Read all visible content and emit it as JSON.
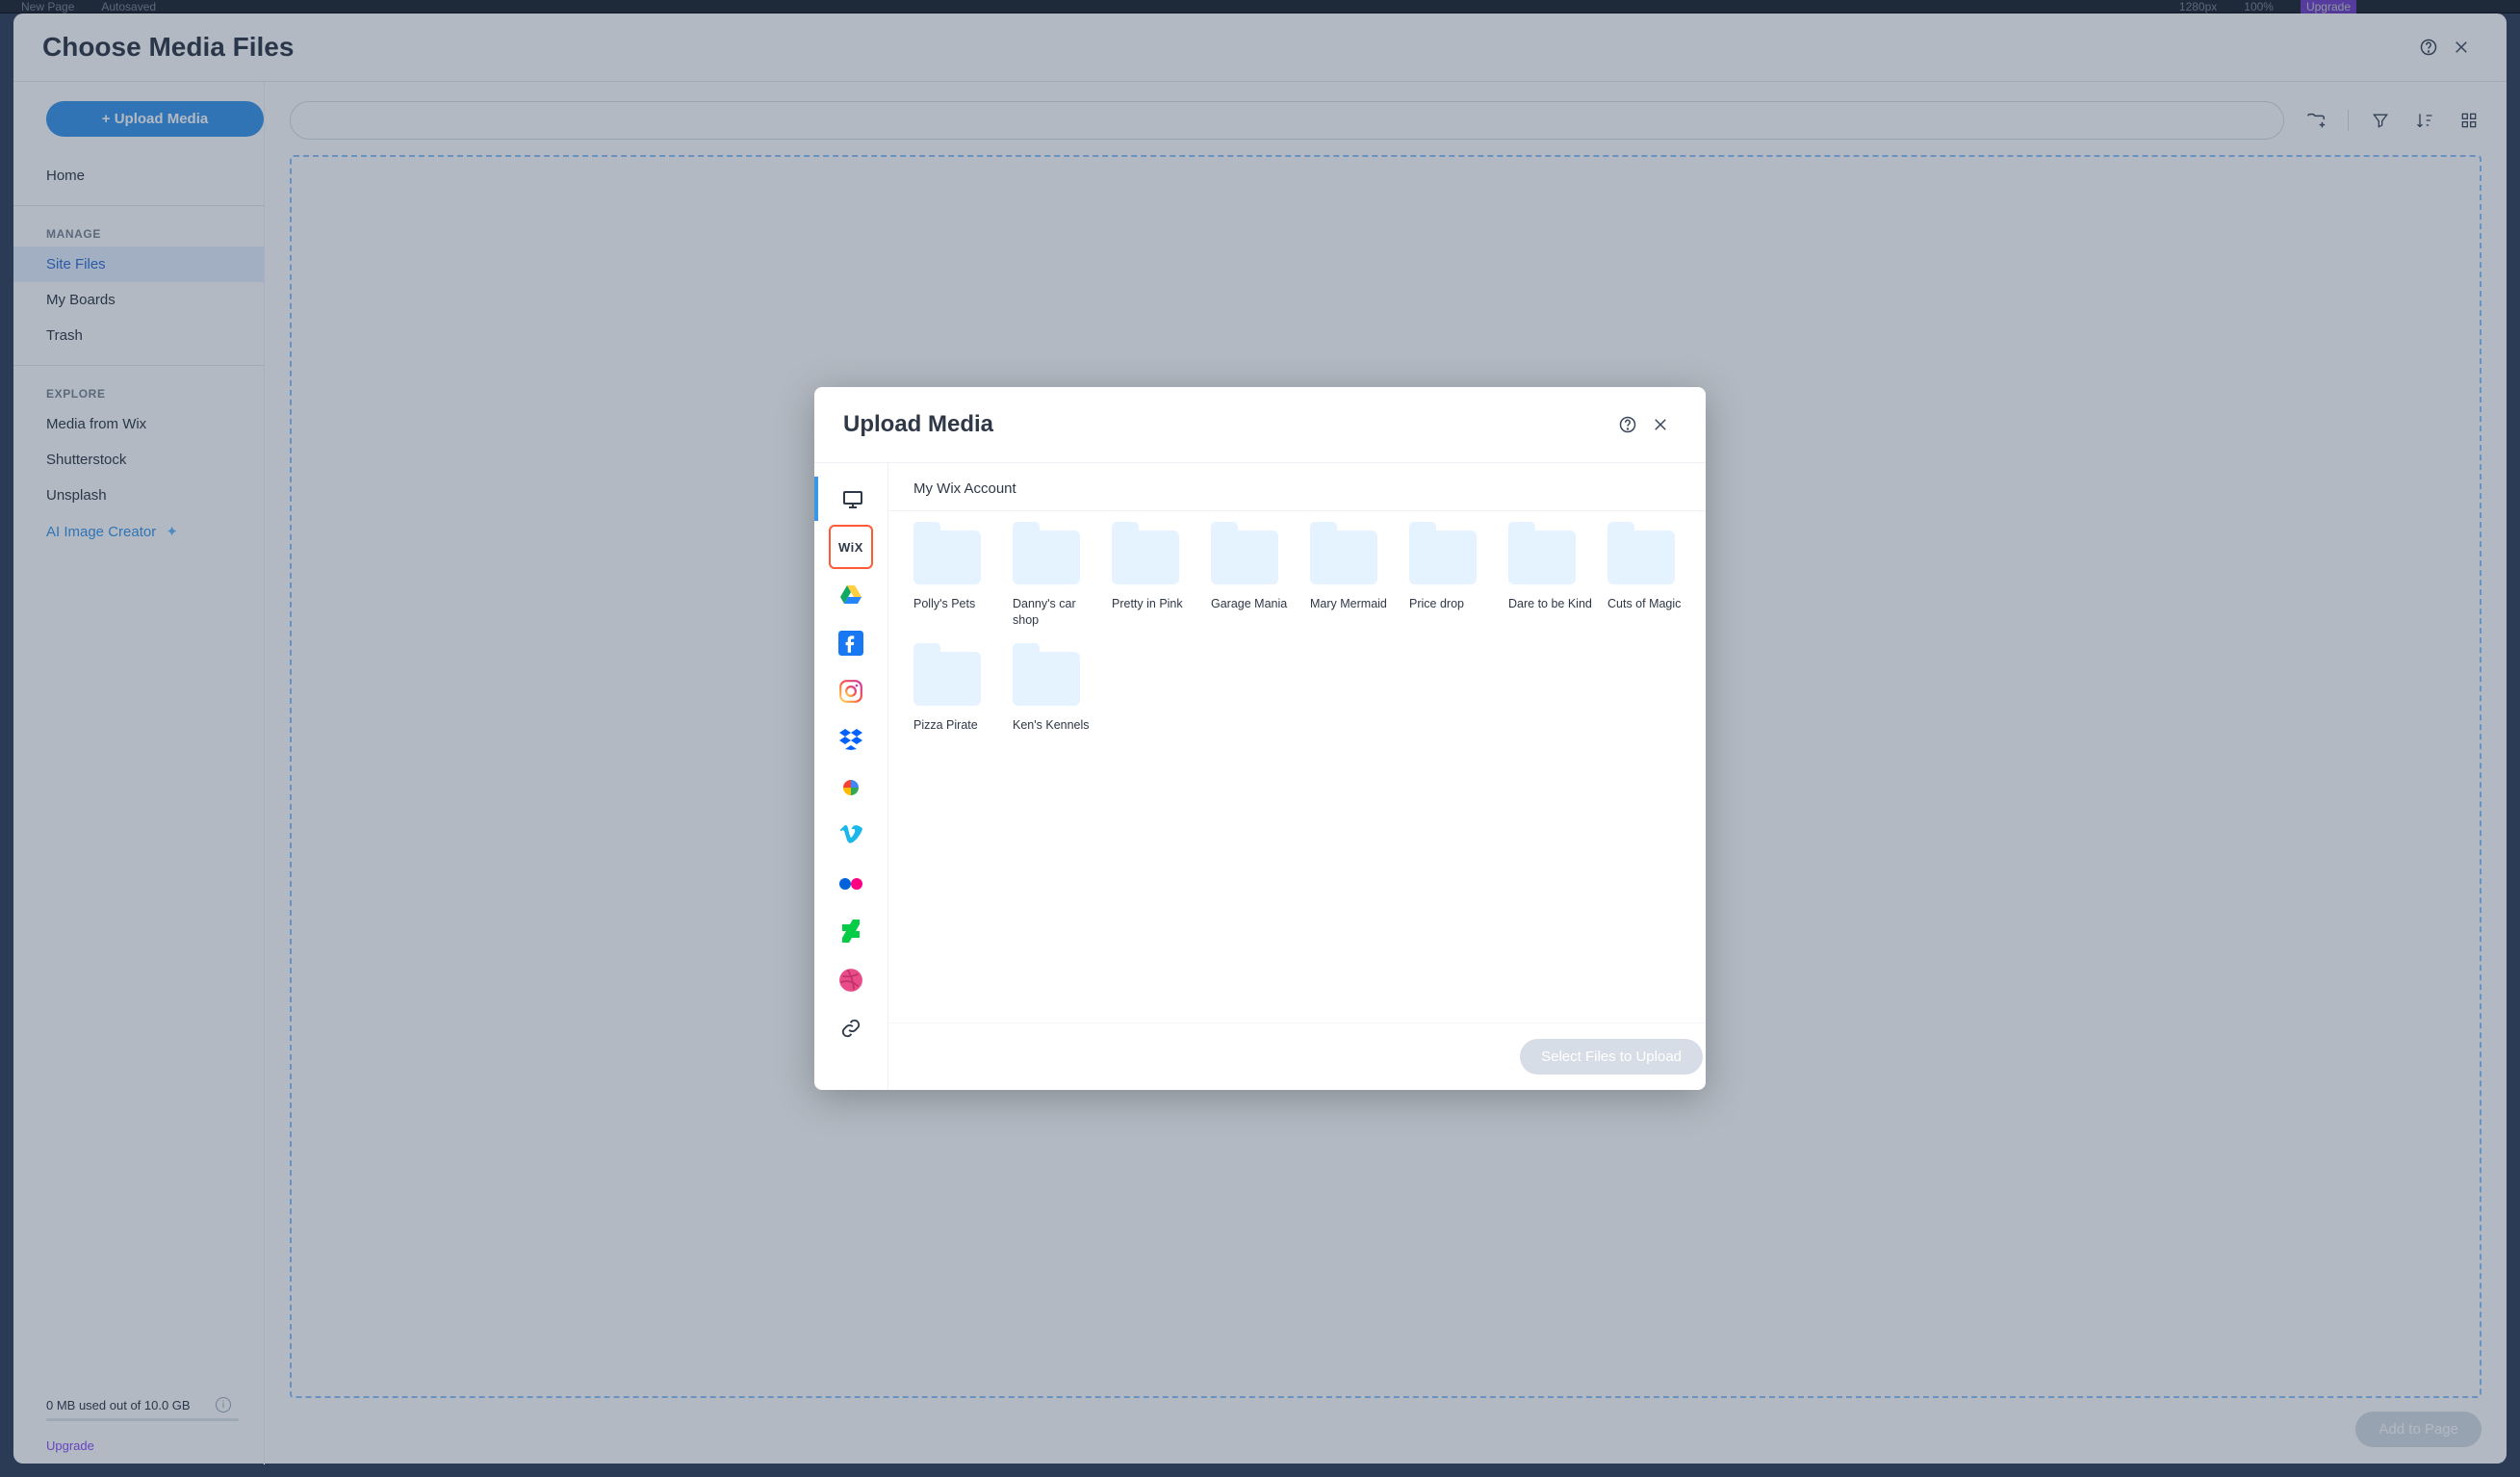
{
  "topbar": {
    "new_page": "New Page",
    "autosaved": "Autosaved",
    "zoom_px": "1280px",
    "zoom_pct": "100%",
    "upgrade": "Upgrade"
  },
  "outer": {
    "title": "Choose Media Files",
    "upload_btn": "+ Upload Media",
    "nav": {
      "home": "Home",
      "manage": "MANAGE",
      "site_files": "Site Files",
      "my_boards": "My Boards",
      "trash": "Trash",
      "explore": "EXPLORE",
      "media_from_wix": "Media from Wix",
      "shutterstock": "Shutterstock",
      "unsplash": "Unsplash",
      "ai": "AI Image Creator"
    },
    "storage": "0 MB used out of 10.0 GB",
    "upgrade": "Upgrade",
    "add_to_page": "Add to Page"
  },
  "inner": {
    "title": "Upload Media",
    "breadcrumb": "My Wix Account",
    "sources": [
      "computer",
      "wix",
      "google-drive",
      "facebook",
      "instagram",
      "dropbox",
      "google-photos",
      "vimeo",
      "flickr",
      "deviantart",
      "dribbble",
      "link"
    ],
    "folders": [
      {
        "label": "Polly's Pets"
      },
      {
        "label": "Danny's car shop"
      },
      {
        "label": "Pretty in Pink"
      },
      {
        "label": "Garage Mania"
      },
      {
        "label": "Mary Mermaid"
      },
      {
        "label": "Price drop"
      },
      {
        "label": "Dare to be Kind"
      },
      {
        "label": "Cuts of Magic"
      },
      {
        "label": "Pizza Pirate"
      },
      {
        "label": "Ken's Kennels"
      }
    ],
    "select_btn": "Select Files to Upload"
  }
}
